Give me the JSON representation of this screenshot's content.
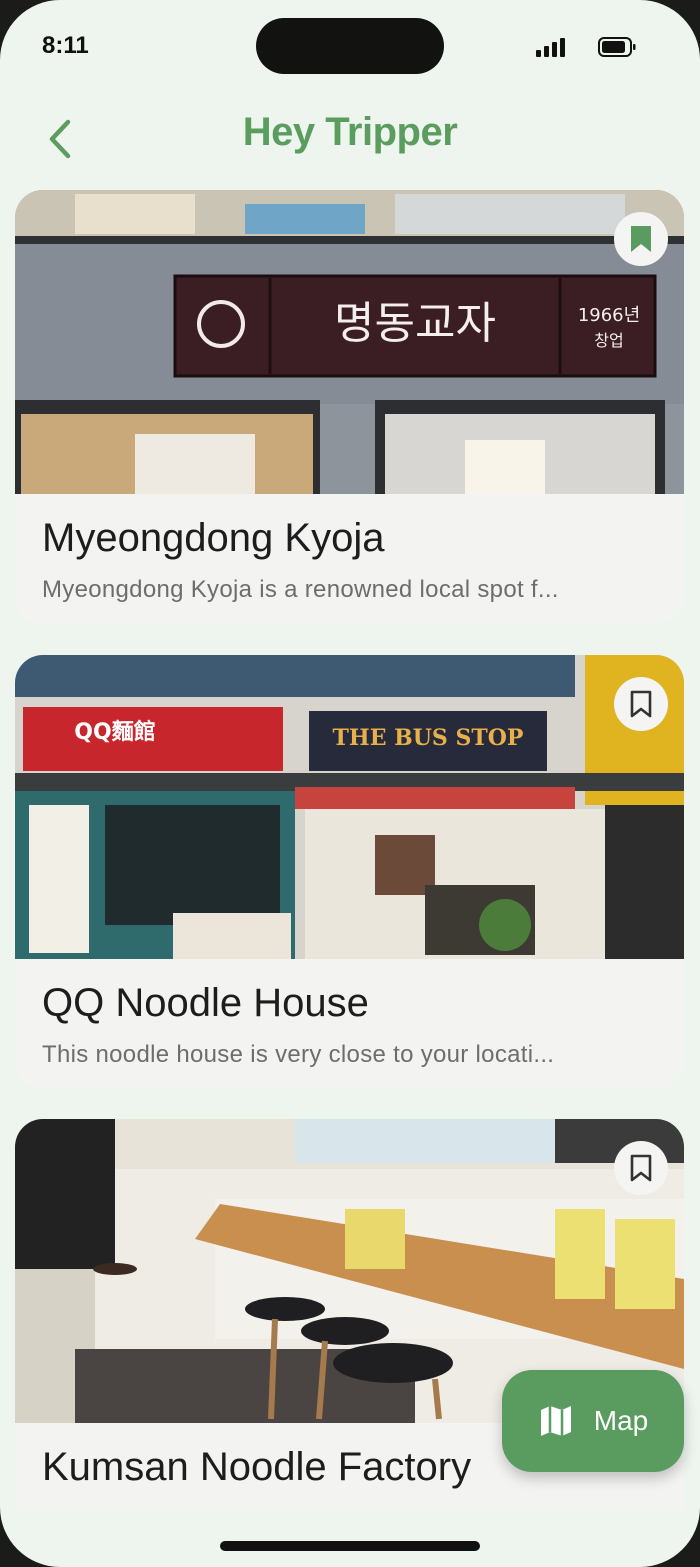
{
  "status_bar": {
    "time": "8:11"
  },
  "header": {
    "title": "Hey Tripper"
  },
  "places": [
    {
      "name": "Myeongdong Kyoja",
      "description": "Myeongdong Kyoja is a renowned local spot f...",
      "bookmarked": true,
      "image_alt": "Storefront with illuminated sign",
      "sign_text": "명동교자",
      "sign_year": "1966년",
      "sign_sub": "창업"
    },
    {
      "name": "QQ Noodle House",
      "description": "This noodle house is very close to your locati...",
      "bookmarked": false,
      "image_alt": "Street storefronts with QQ sign and The Bus Stop sign",
      "sign_text_1": "QQ麵館",
      "sign_text_2": "THE BUS STOP"
    },
    {
      "name": "Kumsan Noodle Factory",
      "description": "",
      "bookmarked": false,
      "image_alt": "Restaurant interior with wooden counter and stools"
    }
  ],
  "map_button": {
    "label": "Map",
    "icon": "map-icon"
  },
  "colors": {
    "accent": "#5a9b5f",
    "background": "#eef5ef",
    "card": "#f3f3f2"
  }
}
